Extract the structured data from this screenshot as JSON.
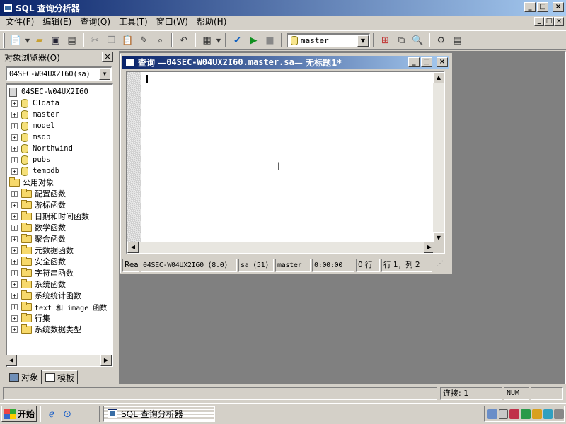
{
  "window": {
    "title": "SQL 查询分析器",
    "caption_buttons": [
      "_",
      "□",
      "×"
    ]
  },
  "menubar": {
    "items": [
      "文件(F)",
      "编辑(E)",
      "查询(Q)",
      "工具(T)",
      "窗口(W)",
      "帮助(H)"
    ]
  },
  "toolbar": {
    "database_combo": "master",
    "icons": [
      "new-query-icon",
      "open-icon",
      "save-icon",
      "insert-template-icon",
      "cut-icon",
      "copy-icon",
      "paste-icon",
      "clear-window-icon",
      "find-icon",
      "undo-icon",
      "results-grid-icon",
      "parse-icon",
      "execute-icon",
      "cancel-icon",
      "database-icon",
      "show-plan-icon",
      "object-browser-icon",
      "object-search-icon",
      "options-icon",
      "show-results-icon"
    ]
  },
  "object_browser": {
    "title": "对象浏览器(O)",
    "close": "×",
    "server_combo": "04SEC-W04UX2I60(sa)",
    "tree": {
      "server": "04SEC-W04UX2I60",
      "databases": [
        "CIdata",
        "master",
        "model",
        "msdb",
        "Northwind",
        "pubs",
        "tempdb"
      ],
      "common_objects": "公用对象",
      "folders": [
        "配置函数",
        "游标函数",
        "日期和时间函数",
        "数学函数",
        "聚合函数",
        "元数据函数",
        "安全函数",
        "字符串函数",
        "系统函数",
        "系统统计函数",
        "text 和 image 函数",
        "行集",
        "系统数据类型"
      ]
    },
    "tabs": [
      "对象",
      "模板"
    ]
  },
  "query_window": {
    "title_prefix": "查询 — ",
    "title_conn": "04SEC-W04UX2I60.master.sa",
    "title_suffix": " — 无标题1*",
    "status": {
      "state": "Ready",
      "server": "04SEC-W04UX2I60 (8.0)",
      "user": "sa (51)",
      "database": "master",
      "time": "0:00:00",
      "rows": "0 行",
      "position": "行 1，列 2"
    }
  },
  "app_status": {
    "connections": "连接: 1",
    "num": "NUM"
  },
  "taskbar": {
    "start": "开始",
    "task": "SQL 查询分析器"
  }
}
